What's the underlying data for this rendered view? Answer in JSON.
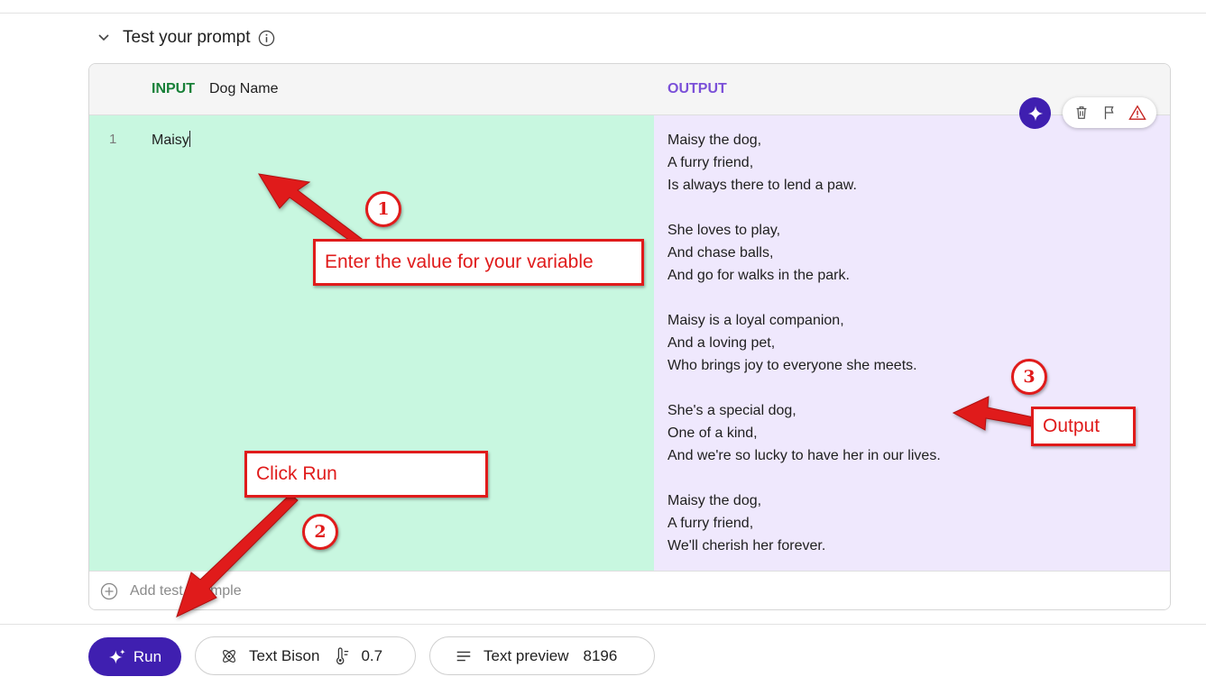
{
  "section": {
    "title": "Test your prompt"
  },
  "table": {
    "input_label": "INPUT",
    "variable_name": "Dog Name",
    "output_label": "OUTPUT",
    "rows": [
      {
        "number": "1",
        "input": "Maisy",
        "output": "Maisy the dog,\nA furry friend,\nIs always there to lend a paw.\n\nShe loves to play,\nAnd chase balls,\nAnd go for walks in the park.\n\nMaisy is a loyal companion,\nAnd a loving pet,\nWho brings joy to everyone she meets.\n\nShe's a special dog,\nOne of a kind,\nAnd we're so lucky to have her in our lives.\n\nMaisy the dog,\nA furry friend,\nWe'll cherish her forever."
      }
    ],
    "add_example": "Add test example"
  },
  "toolbar": {
    "run_label": "Run",
    "model_name": "Text Bison",
    "temperature": "0.7",
    "format_label": "Text preview",
    "token_limit": "8196"
  },
  "annotations": {
    "step1_number": "1",
    "step1_text": "Enter the value for your variable",
    "step2_number": "2",
    "step2_text": "Click Run",
    "step3_number": "3",
    "step3_text": "Output",
    "color": "#e01b1b"
  },
  "colors": {
    "accent": "#3f1fb0",
    "input_green": "#188038",
    "output_purple": "#7b50d8",
    "input_bg": "#c8f7e0",
    "output_bg": "#efe8fd"
  }
}
